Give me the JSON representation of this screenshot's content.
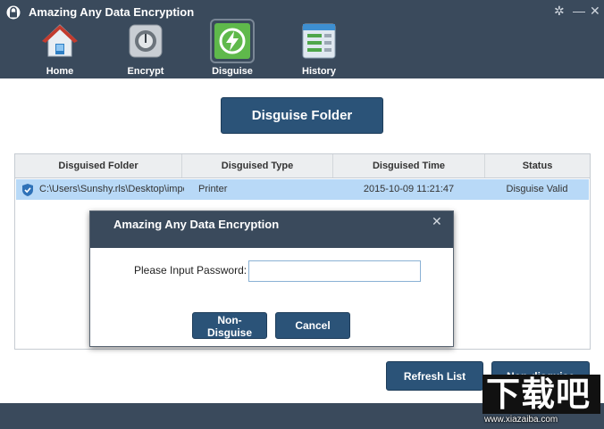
{
  "app": {
    "title": "Amazing Any Data Encryption"
  },
  "window_controls": {
    "settings_icon": "gear-icon",
    "minimize_icon": "minimize-icon",
    "close_icon": "close-icon"
  },
  "nav": [
    {
      "label": "Home",
      "icon": "home-icon",
      "active": false
    },
    {
      "label": "Encrypt",
      "icon": "safe-icon",
      "active": false
    },
    {
      "label": "Disguise",
      "icon": "disguise-icon",
      "active": true
    },
    {
      "label": "History",
      "icon": "history-icon",
      "active": false
    }
  ],
  "main": {
    "disguise_button": "Disguise Folder"
  },
  "table": {
    "columns": [
      "Disguised Folder",
      "Disguised Type",
      "Disguised Time",
      "Status"
    ],
    "rows": [
      {
        "folder": "C:\\Users\\Sunshy.rls\\Desktop\\impor",
        "type": "Printer",
        "time": "2015-10-09 11:21:47",
        "status": "Disguise Valid"
      }
    ]
  },
  "dialog": {
    "title": "Amazing Any Data Encryption",
    "password_label": "Please Input Password:",
    "password_value": "",
    "non_disguise_button": "Non-Disguise",
    "cancel_button": "Cancel"
  },
  "bottom": {
    "refresh_button": "Refresh List",
    "non_disguise_button": "Non-disguise"
  },
  "watermark": {
    "text": "下载吧",
    "url_text": "www.xiazaiba.com"
  },
  "colors": {
    "header_bg": "#3a4a5c",
    "button_bg": "#2b5378",
    "row_selected": "#b8d9f7"
  }
}
